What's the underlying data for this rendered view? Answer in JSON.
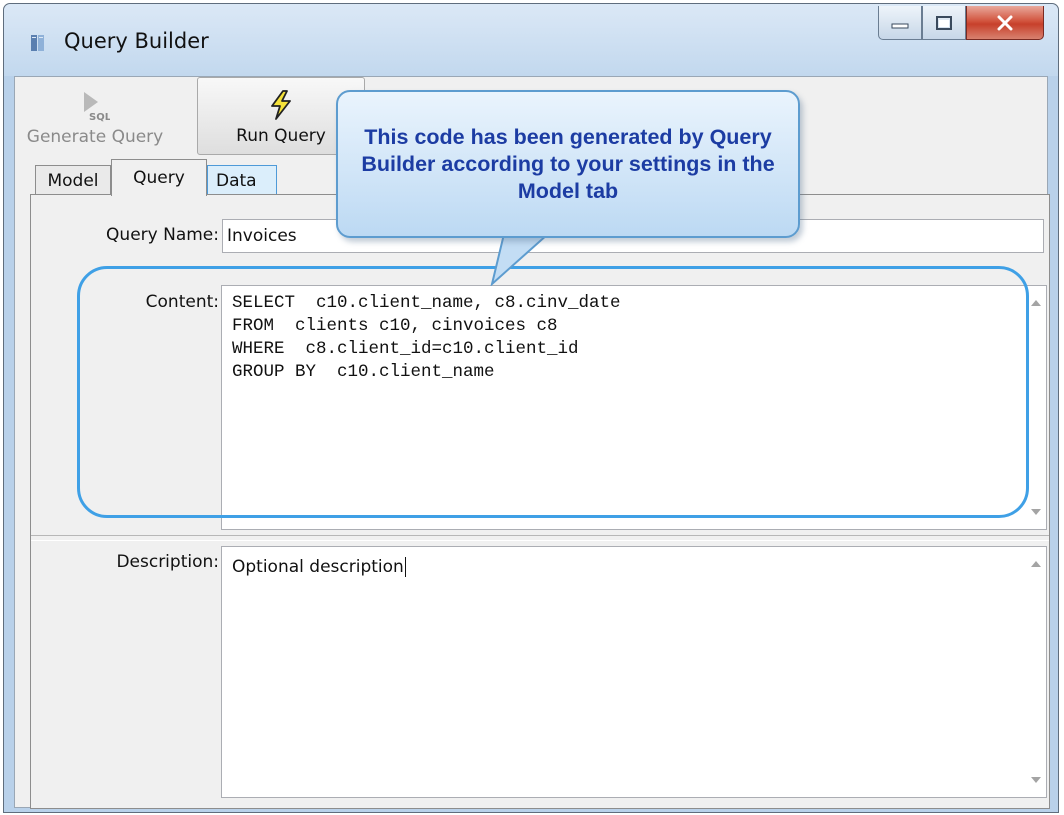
{
  "window": {
    "title": "Query Builder",
    "controls": [
      "minimize",
      "maximize",
      "close"
    ]
  },
  "toolbar": {
    "generate_label": "Generate Query",
    "generate_icon_text": "SQL",
    "run_label": "Run Query"
  },
  "tabs": [
    {
      "label": "Model",
      "active": false
    },
    {
      "label": "Query",
      "active": true
    },
    {
      "label": "Data",
      "active": false
    }
  ],
  "form": {
    "query_name_label": "Query Name:",
    "query_name_value": "Invoices",
    "content_label": "Content:",
    "content_lines": [
      "SELECT  c10.client_name, c8.cinv_date",
      "FROM  clients c10, cinvoices c8",
      "WHERE  c8.client_id=c10.client_id",
      "GROUP BY  c10.client_name"
    ],
    "description_label": "Description:",
    "description_value": "Optional description"
  },
  "callout": {
    "text": "This code has been generated by Query Builder according to your settings in the Model tab"
  },
  "colors": {
    "highlight": "#3fa0e6",
    "callout_text": "#1c3ca3",
    "run_icon": "#f5e23a"
  }
}
